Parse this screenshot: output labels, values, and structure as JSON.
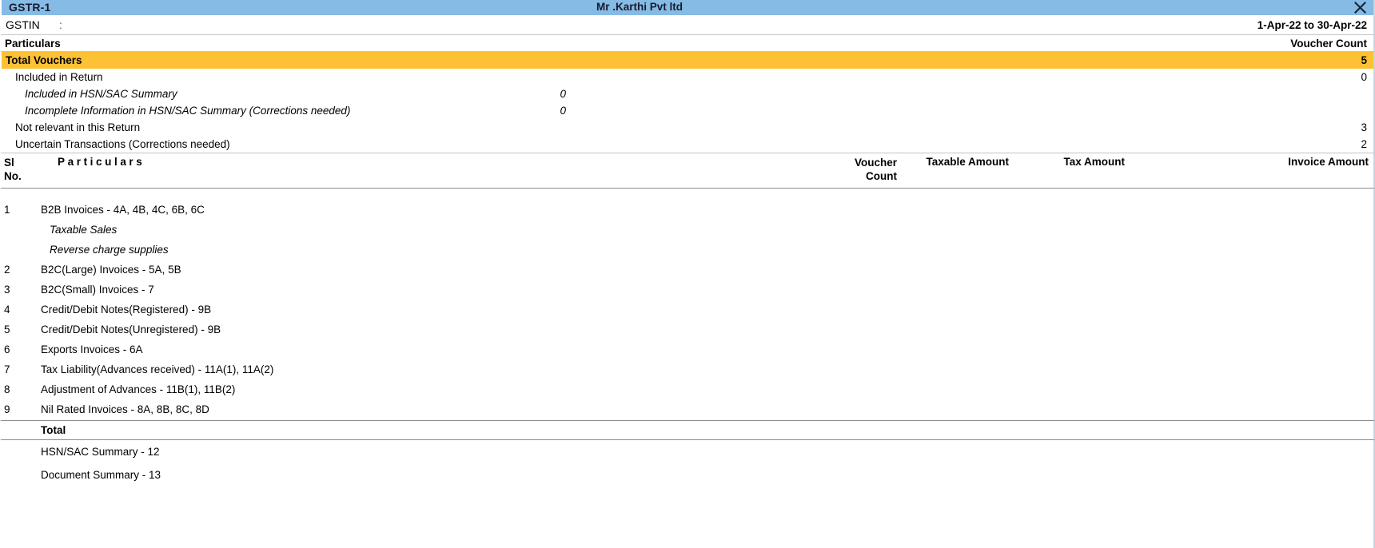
{
  "window": {
    "app_title": "GSTR-1",
    "company_title": "Mr .Karthi Pvt ltd",
    "close_icon": "close-icon"
  },
  "info": {
    "gstin_label": "GSTIN",
    "gstin_colon": ":",
    "gstin_value": "",
    "period": "1-Apr-22 to 30-Apr-22"
  },
  "particulars_header": {
    "left": "Particulars",
    "right": "Voucher Count"
  },
  "summary": {
    "total_vouchers": {
      "label": "Total Vouchers",
      "value": "5"
    },
    "rows": [
      {
        "label": "Included in Return",
        "indent": 1,
        "mid": "",
        "value": "0"
      },
      {
        "label": "Included in HSN/SAC Summary",
        "indent": 2,
        "mid": "0",
        "value": ""
      },
      {
        "label": "Incomplete Information in HSN/SAC Summary (Corrections needed)",
        "indent": 2,
        "mid": "0",
        "value": ""
      },
      {
        "label": "Not relevant in this Return",
        "indent": 1,
        "mid": "",
        "value": "3"
      },
      {
        "label": "Uncertain Transactions (Corrections needed)",
        "indent": 1,
        "mid": "",
        "value": "2"
      }
    ]
  },
  "table": {
    "columns": {
      "sl_line1": "Sl",
      "sl_line2": "No.",
      "particulars": "Particulars",
      "voucher_count_line1": "Voucher",
      "voucher_count_line2": "Count",
      "taxable_amount": "Taxable Amount",
      "tax_amount": "Tax Amount",
      "invoice_amount": "Invoice Amount"
    },
    "rows": [
      {
        "sl": "1",
        "particulars": "B2B Invoices - 4A, 4B, 4C, 6B, 6C",
        "voucher_count": "",
        "taxable_amount": "",
        "tax_amount": "",
        "invoice_amount": "",
        "sub": false
      },
      {
        "sl": "",
        "particulars": "Taxable Sales",
        "voucher_count": "",
        "taxable_amount": "",
        "tax_amount": "",
        "invoice_amount": "",
        "sub": true
      },
      {
        "sl": "",
        "particulars": "Reverse charge supplies",
        "voucher_count": "",
        "taxable_amount": "",
        "tax_amount": "",
        "invoice_amount": "",
        "sub": true
      },
      {
        "sl": "2",
        "particulars": "B2C(Large) Invoices - 5A, 5B",
        "voucher_count": "",
        "taxable_amount": "",
        "tax_amount": "",
        "invoice_amount": "",
        "sub": false
      },
      {
        "sl": "3",
        "particulars": "B2C(Small) Invoices - 7",
        "voucher_count": "",
        "taxable_amount": "",
        "tax_amount": "",
        "invoice_amount": "",
        "sub": false
      },
      {
        "sl": "4",
        "particulars": "Credit/Debit Notes(Registered) - 9B",
        "voucher_count": "",
        "taxable_amount": "",
        "tax_amount": "",
        "invoice_amount": "",
        "sub": false
      },
      {
        "sl": "5",
        "particulars": "Credit/Debit Notes(Unregistered) - 9B",
        "voucher_count": "",
        "taxable_amount": "",
        "tax_amount": "",
        "invoice_amount": "",
        "sub": false
      },
      {
        "sl": "6",
        "particulars": "Exports Invoices - 6A",
        "voucher_count": "",
        "taxable_amount": "",
        "tax_amount": "",
        "invoice_amount": "",
        "sub": false
      },
      {
        "sl": "7",
        "particulars": "Tax Liability(Advances received) - 11A(1), 11A(2)",
        "voucher_count": "",
        "taxable_amount": "",
        "tax_amount": "",
        "invoice_amount": "",
        "sub": false
      },
      {
        "sl": "8",
        "particulars": "Adjustment of Advances - 11B(1), 11B(2)",
        "voucher_count": "",
        "taxable_amount": "",
        "tax_amount": "",
        "invoice_amount": "",
        "sub": false
      },
      {
        "sl": "9",
        "particulars": "Nil Rated Invoices - 8A, 8B, 8C, 8D",
        "voucher_count": "",
        "taxable_amount": "",
        "tax_amount": "",
        "invoice_amount": "",
        "sub": false
      }
    ],
    "total_row": {
      "label": "Total",
      "voucher_count": "",
      "taxable_amount": "",
      "tax_amount": "",
      "invoice_amount": ""
    },
    "footer_rows": [
      {
        "particulars": "HSN/SAC Summary - 12"
      },
      {
        "particulars": "Document Summary - 13"
      }
    ]
  },
  "colors": {
    "titlebar": "#85BBE4",
    "highlight": "#FCC134",
    "rule": "#c4c4c4",
    "rule_dark": "#8a8a8a"
  }
}
